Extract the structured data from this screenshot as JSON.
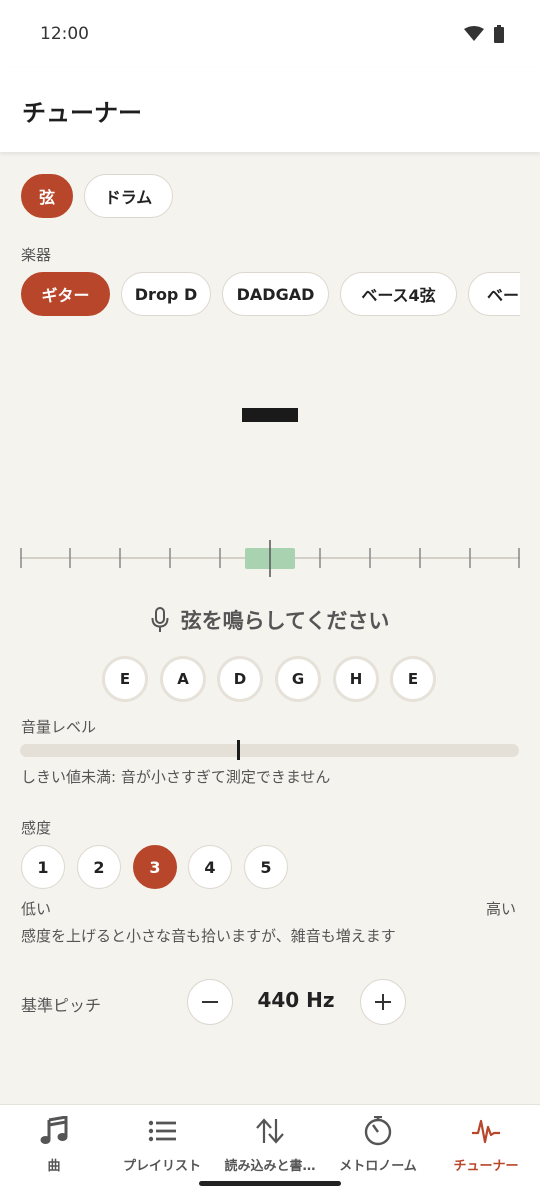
{
  "status": {
    "time": "12:00",
    "icons": [
      "wifi-icon",
      "battery-icon"
    ]
  },
  "app_bar": {
    "title": "チューナー"
  },
  "mode_tabs": [
    {
      "label": "弦",
      "active": true
    },
    {
      "label": "ドラム",
      "active": false
    }
  ],
  "instrument": {
    "label": "楽器",
    "chips": [
      {
        "label": "ギター",
        "active": true
      },
      {
        "label": "Drop D",
        "active": false
      },
      {
        "label": "DADGAD",
        "active": false
      },
      {
        "label": "ベース4弦",
        "active": false
      },
      {
        "label": "ベー",
        "active": false
      }
    ]
  },
  "tuner": {
    "note": "—",
    "prompt": "弦を鳴らしてください",
    "prompt_icon": "microphone-icon",
    "in_tune_color": "#a9d3b0"
  },
  "strings": [
    "E",
    "A",
    "D",
    "G",
    "H",
    "E"
  ],
  "volume": {
    "label": "音量レベル",
    "message": "しきい値未満: 音が小さすぎて測定できません",
    "threshold_fraction": 0.43
  },
  "sensitivity": {
    "label": "感度",
    "options": [
      "1",
      "2",
      "3",
      "4",
      "5"
    ],
    "selected": "3",
    "low_label": "低い",
    "high_label": "高い",
    "hint": "感度を上げると小さな音も拾いますが、雑音も増えます"
  },
  "reference_pitch": {
    "label": "基準ピッチ",
    "value": "440 Hz",
    "decrease_icon": "minus-icon",
    "increase_icon": "plus-icon"
  },
  "bottom_nav": [
    {
      "label": "曲",
      "icon": "music-note-icon",
      "active": false
    },
    {
      "label": "プレイリスト",
      "icon": "list-icon",
      "active": false
    },
    {
      "label": "読み込みと書…",
      "icon": "import-export-icon",
      "active": false
    },
    {
      "label": "メトロノーム",
      "icon": "metronome-icon",
      "active": false
    },
    {
      "label": "チューナー",
      "icon": "tuner-wave-icon",
      "active": true
    }
  ],
  "colors": {
    "accent": "#b8462a",
    "background": "#f5f3ee",
    "surface": "#ffffff"
  }
}
